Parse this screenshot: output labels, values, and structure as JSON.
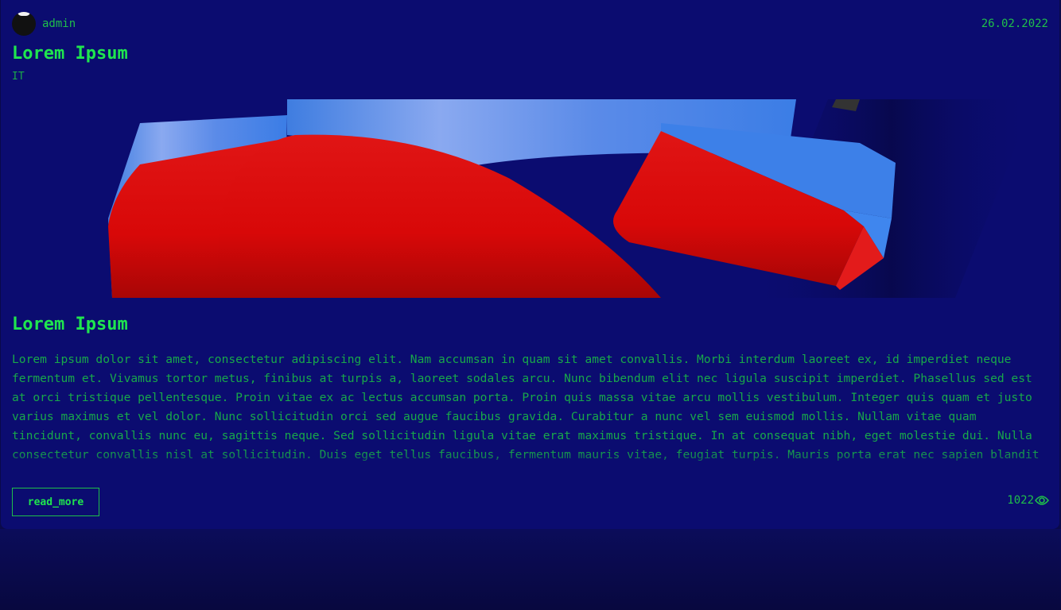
{
  "post": {
    "author": "admin",
    "date": "26.02.2022",
    "title": "Lorem Ipsum",
    "category": "IT",
    "content_title": "Lorem Ipsum",
    "excerpt": "Lorem ipsum dolor sit amet, consectetur adipiscing elit. Nam accumsan in quam sit amet convallis. Morbi interdum laoreet ex, id imperdiet neque fermentum et. Vivamus tortor metus, finibus at turpis a, laoreet sodales arcu. Nunc bibendum elit nec ligula suscipit imperdiet. Phasellus sed est at orci tristique pellentesque. Proin vitae ex ac lectus accumsan porta. Proin quis massa vitae arcu mollis vestibulum. Integer quis quam et justo varius maximus et vel dolor. Nunc sollicitudin orci sed augue faucibus gravida. Curabitur a nunc vel sem euismod mollis. Nullam vitae quam tincidunt, convallis nunc eu, sagittis neque. Sed sollicitudin ligula vitae erat maximus tristique. In at consequat nibh, eget molestie dui. Nulla consectetur convallis nisl at sollicitudin. Duis eget tellus faucibus, fermentum mauris vitae, feugiat turpis. Mauris porta erat nec sapien blandit",
    "read_more_label": "read_more",
    "views": "1022"
  },
  "icons": {
    "avatar": "avatar",
    "views": "eye-icon",
    "hero_image": "red-blue-3d-logo"
  },
  "colors": {
    "background": "#0b0c70",
    "accent": "#1fe64e",
    "text": "#18a84a"
  }
}
